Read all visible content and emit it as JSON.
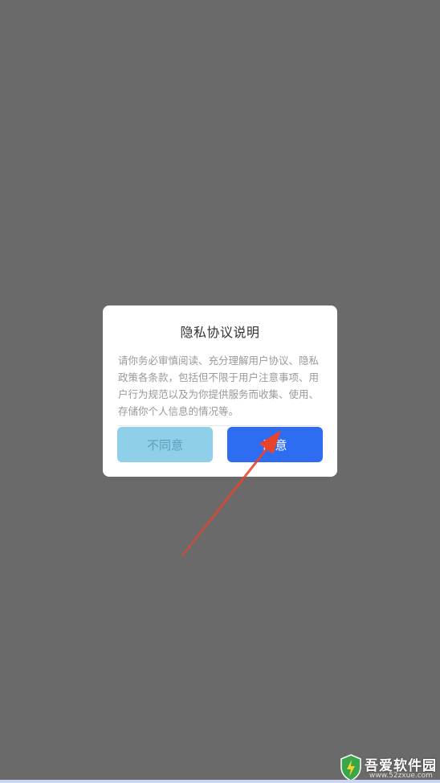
{
  "dialog": {
    "title": "隐私协议说明",
    "body": "请你务必审慎阅读、充分理解用户协议、隐私政策各条款，包括但不限于用户注意事项、用户行为规范以及为你提供服务而收集、使用、存储你个人信息的情况等。",
    "disagree_label": "不同意",
    "agree_label": "同意"
  },
  "watermark": {
    "title": "吾爱软件园",
    "url": "www.52zxue.com"
  },
  "colors": {
    "overlay": "#6a6a6a",
    "agree_button": "#2e6df2",
    "disagree_button": "#8fcfea",
    "annotation_arrow": "#e8432c"
  },
  "icons": {
    "arrow": "red-annotation-arrow",
    "watermark_logo": "green-shield-icon"
  }
}
